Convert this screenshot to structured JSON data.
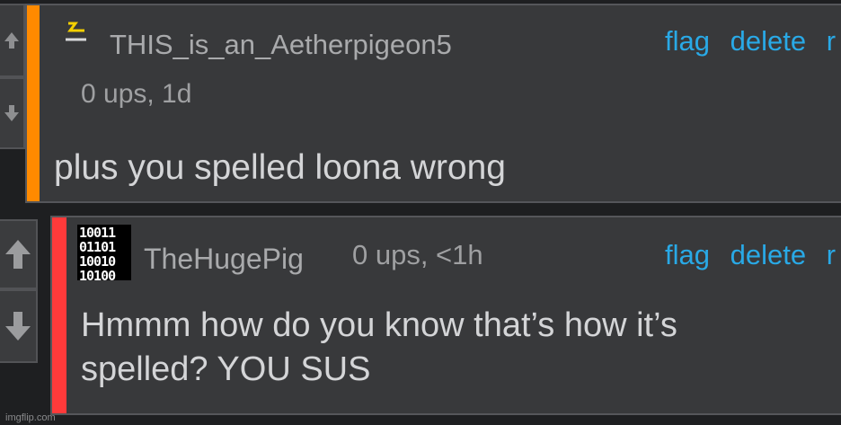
{
  "comment1": {
    "username": "THIS_is_an_Aetherpigeon5",
    "meta": "0 ups, 1d",
    "text": "plus you spelled loona wrong",
    "accent_color": "#ff8a00",
    "actions": {
      "flag": "flag",
      "delete": "delete",
      "reply": "r"
    }
  },
  "comment2": {
    "username": "TheHugePig",
    "meta": "0 ups, <1h",
    "text_line1": "Hmmm how do you know that’s how it’s",
    "text_line2": "spelled? YOU SUS",
    "accent_color": "#ff3a3a",
    "avatar_lines": [
      "10011",
      "01101",
      "10010",
      "10100"
    ],
    "actions": {
      "flag": "flag",
      "delete": "delete",
      "reply": "r"
    }
  },
  "footer": {
    "watermark": "imgflip.com"
  },
  "icons": [
    "upvote-arrow-icon",
    "downvote-arrow-icon",
    "lightning-icon",
    "binary-avatar"
  ]
}
